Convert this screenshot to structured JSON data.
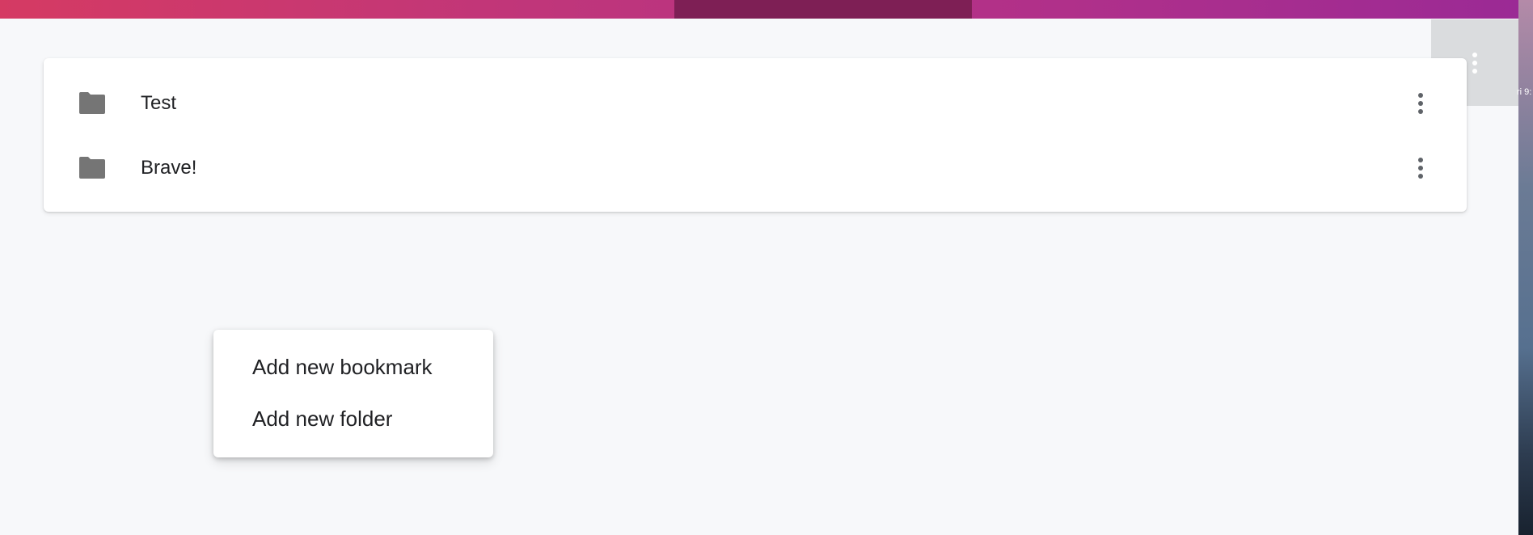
{
  "folders": [
    {
      "name": "Test",
      "icon": "folder-icon",
      "menu_icon": "more-vert-icon"
    },
    {
      "name": "Brave!",
      "icon": "folder-icon",
      "menu_icon": "more-vert-icon"
    }
  ],
  "overflow_menu_icon": "more-vert-icon",
  "context_menu": {
    "items": [
      {
        "label": "Add new bookmark"
      },
      {
        "label": "Add new folder"
      }
    ]
  },
  "desktop_edge_text": "ri 9:",
  "colors": {
    "top_bar_start": "#d53a63",
    "top_bar_end": "#9b2a95",
    "top_bar_segment": "#7e1f55",
    "background": "#f7f8fa",
    "folder_icon": "#757575",
    "overflow_button_bg": "#dadcde"
  }
}
